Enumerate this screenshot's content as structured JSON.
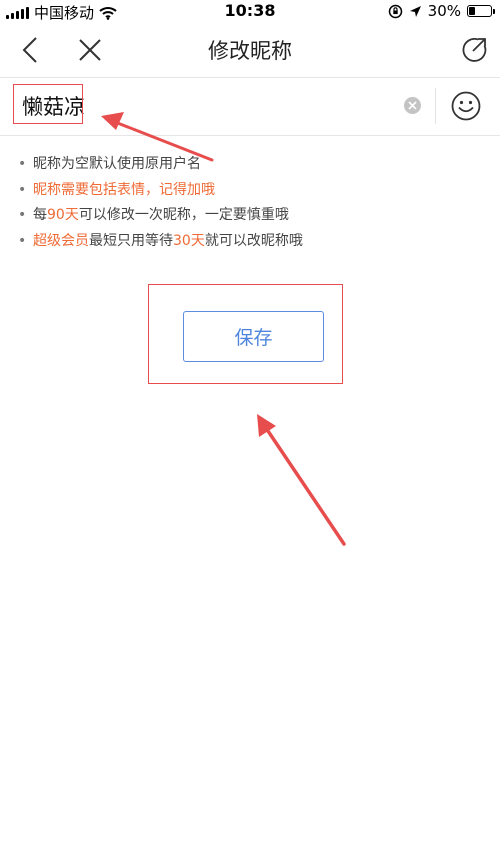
{
  "status_bar": {
    "carrier": "中国移动",
    "time": "10:38",
    "battery": "30%",
    "battery_level": 0.3
  },
  "nav": {
    "title": "修改昵称",
    "back_icon": "chevron-left-icon",
    "close_icon": "close-icon",
    "refresh_icon": "refresh-icon"
  },
  "input": {
    "value": "懒菇凉",
    "clear_icon": "clear-icon",
    "emoji_icon": "emoji-icon"
  },
  "tips": [
    {
      "parts": [
        {
          "text": "昵称为空默认使用原用户名",
          "highlight": false
        }
      ]
    },
    {
      "parts": [
        {
          "text": "昵称需要包括表情，记得加哦",
          "highlight": true
        }
      ],
      "orange_line": true
    },
    {
      "parts": [
        {
          "text": "每",
          "highlight": false
        },
        {
          "text": "90天",
          "highlight": true
        },
        {
          "text": "可以修改一次昵称，一定要慎重哦",
          "highlight": false
        }
      ]
    },
    {
      "parts": [
        {
          "text": "超级会员",
          "highlight": true
        },
        {
          "text": "最短只用等待",
          "highlight": false
        },
        {
          "text": "30天",
          "highlight": true
        },
        {
          "text": "就可以改昵称哦",
          "highlight": false
        }
      ]
    }
  ],
  "bullet": "•",
  "save_button": {
    "label": "保存"
  },
  "colors": {
    "accent_blue": "#4f86dd",
    "highlight_orange": "#ef6a35",
    "annotation_red": "#e84d4d"
  }
}
